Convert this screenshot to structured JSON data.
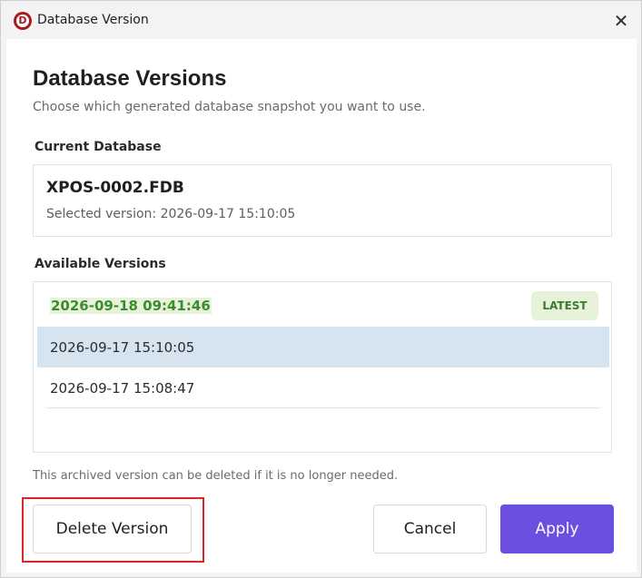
{
  "window": {
    "title": "Database Version",
    "app_icon_letter": "D",
    "close_glyph": "✕"
  },
  "dialog": {
    "heading": "Database Versions",
    "subtitle": "Choose which generated database snapshot you want to use."
  },
  "current": {
    "label": "Current Database",
    "name": "XPOS-0002.FDB",
    "selected_version": "Selected version: 2026-09-17 15:10:05"
  },
  "available": {
    "label": "Available Versions",
    "versions": [
      {
        "timestamp": "2026-09-18 09:41:46",
        "badge": "LATEST",
        "state": "latest"
      },
      {
        "timestamp": "2026-09-17 15:10:05",
        "badge": "",
        "state": "selected"
      },
      {
        "timestamp": "2026-09-17 15:08:47",
        "badge": "",
        "state": "normal"
      }
    ]
  },
  "hint": "This archived version can be deleted if it is no longer needed.",
  "buttons": {
    "delete": "Delete Version",
    "cancel": "Cancel",
    "apply": "Apply"
  },
  "colors": {
    "accent": "#6c4fe0",
    "latest_green": "#3d8b2f",
    "selected_row": "#d6e4f0",
    "highlight_red": "#e02424"
  },
  "icons": [
    "app-logo-icon",
    "close-icon"
  ]
}
